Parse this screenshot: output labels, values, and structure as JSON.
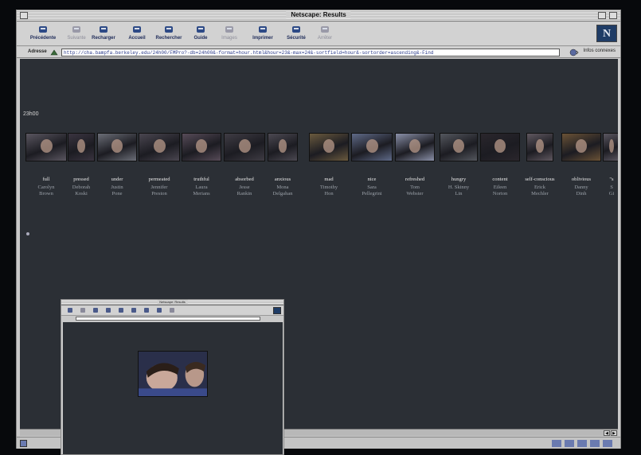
{
  "window": {
    "title": "Netscape: Results"
  },
  "toolbar": [
    {
      "label": "Précédente",
      "icon": "back-arrow-icon",
      "enabled": true
    },
    {
      "label": "Suivante",
      "icon": "forward-arrow-icon",
      "enabled": false
    },
    {
      "label": "Recharger",
      "icon": "reload-icon",
      "enabled": true
    },
    {
      "label": "Accueil",
      "icon": "home-icon",
      "enabled": true
    },
    {
      "label": "Rechercher",
      "icon": "search-icon",
      "enabled": true
    },
    {
      "label": "Guide",
      "icon": "guide-icon",
      "enabled": true
    },
    {
      "label": "Images",
      "icon": "images-icon",
      "enabled": false
    },
    {
      "label": "Imprimer",
      "icon": "print-icon",
      "enabled": true
    },
    {
      "label": "Sécurité",
      "icon": "lock-icon",
      "enabled": true
    },
    {
      "label": "Arrêter",
      "icon": "stop-icon",
      "enabled": false
    }
  ],
  "location": {
    "label": "Adresse",
    "url": "http://cha.bampfa.berkeley.edu/24h00/FMPro?-db=24h00&-format=hour.html&hour=23&-max=24&-sortfield=hour&-sortorder=ascending&-Find",
    "infos_label": "Infos connexes"
  },
  "page": {
    "hour_label": "23h00",
    "entries": [
      {
        "emotion": "full",
        "first": "Carolyn",
        "last": "Brown",
        "color": "#5a5660"
      },
      {
        "emotion": "pressed",
        "first": "Deborah",
        "last": "Koski",
        "color": "#3a3440"
      },
      {
        "emotion": "under",
        "first": "Justin",
        "last": "Pone",
        "color": "#6b6e77"
      },
      {
        "emotion": "permeated",
        "first": "Jennifer",
        "last": "Preston",
        "color": "#4a4650"
      },
      {
        "emotion": "truthful",
        "first": "Laura",
        "last": "Merians",
        "color": "#574b58"
      },
      {
        "emotion": "absorbed",
        "first": "Jesse",
        "last": "Rankin",
        "color": "#3f3c44"
      },
      {
        "emotion": "anxious",
        "first": "Mona",
        "last": "Delgahan",
        "color": "#4c4952"
      },
      {
        "emotion": "mad",
        "first": "Timothy",
        "last": "Hon",
        "color": "#6a5a3e"
      },
      {
        "emotion": "nice",
        "first": "Sara",
        "last": "Pellegrini",
        "color": "#5f6a88"
      },
      {
        "emotion": "refreshed",
        "first": "Tom",
        "last": "Webster",
        "color": "#8a90a8"
      },
      {
        "emotion": "hungry",
        "first": "H. Skinny",
        "last": "Lin",
        "color": "#54575e"
      },
      {
        "emotion": "content",
        "first": "Eileen",
        "last": "Norton",
        "color": "#2a262c"
      },
      {
        "emotion": "self-conscious",
        "first": "Erick",
        "last": "Mechler",
        "color": "#605860"
      },
      {
        "emotion": "oblivious",
        "first": "Danny",
        "last": "Dinh",
        "color": "#6a5236"
      },
      {
        "emotion": "\"s",
        "first": "S",
        "last": "Gi",
        "color": "#5a5660"
      }
    ]
  },
  "popup": {
    "title": "Netscape: Results"
  }
}
